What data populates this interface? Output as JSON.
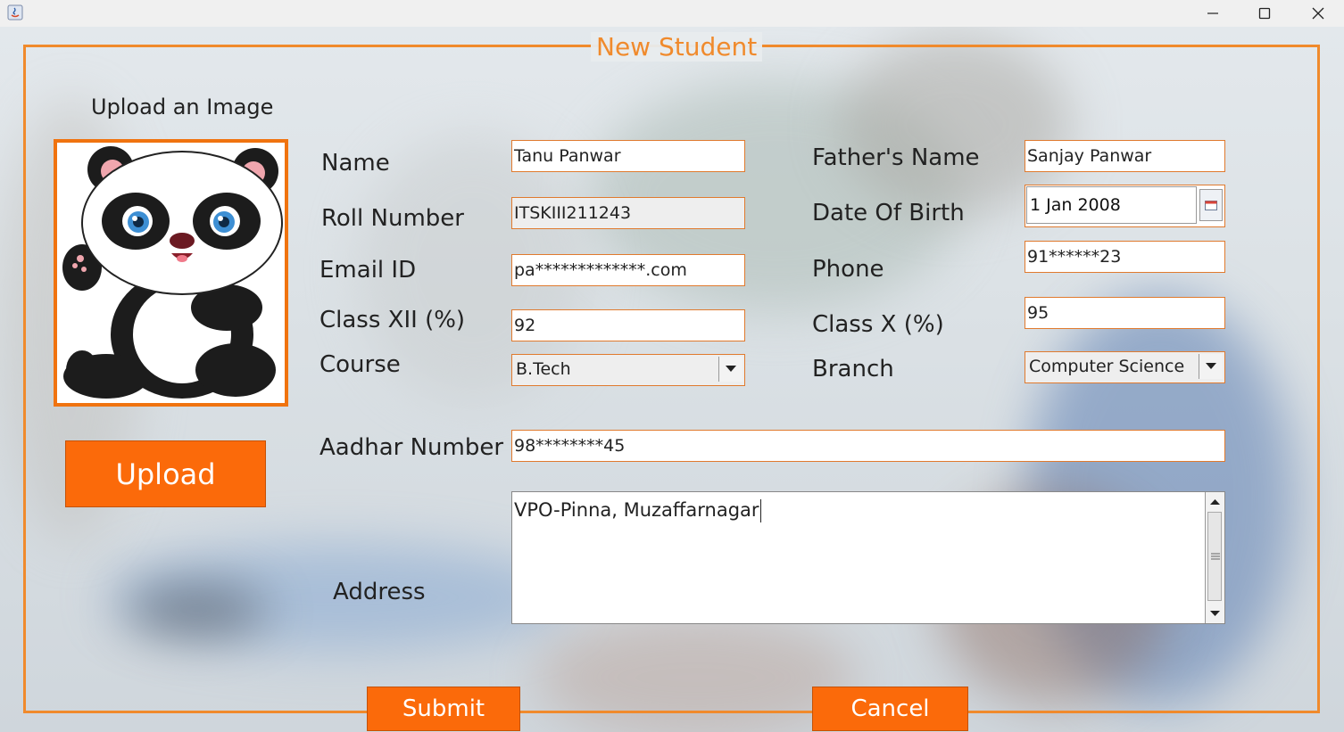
{
  "window": {
    "title": ""
  },
  "form": {
    "title": "New Student",
    "upload_label": "Upload an Image",
    "upload_button": "Upload",
    "fields": {
      "name": {
        "label": "Name",
        "value": "Tanu Panwar"
      },
      "roll": {
        "label": "Roll Number",
        "value": "ITSKIII211243"
      },
      "email": {
        "label": "Email ID",
        "value": "pa*************.com"
      },
      "class12": {
        "label": "Class XII (%)",
        "value": "92"
      },
      "course": {
        "label": "Course",
        "value": "B.Tech"
      },
      "father": {
        "label": "Father's Name",
        "value": "Sanjay Panwar"
      },
      "dob": {
        "label": "Date Of Birth",
        "value": "1 Jan 2008"
      },
      "phone": {
        "label": "Phone",
        "value": "91******23"
      },
      "class10": {
        "label": "Class X (%)",
        "value": "95"
      },
      "branch": {
        "label": "Branch",
        "value": "Computer Science"
      },
      "aadhar": {
        "label": "Aadhar Number",
        "value": "98********45"
      },
      "address": {
        "label": "Address",
        "value": "VPO-Pinna, Muzaffarnagar"
      }
    },
    "submit_button": "Submit",
    "cancel_button": "Cancel"
  },
  "colors": {
    "accent": "#f08a2c",
    "button": "#fb6a0a"
  },
  "icons": [
    "java-app-icon",
    "minimize-icon",
    "maximize-icon",
    "close-icon",
    "calendar-icon",
    "chevron-down-icon",
    "panda-image"
  ]
}
